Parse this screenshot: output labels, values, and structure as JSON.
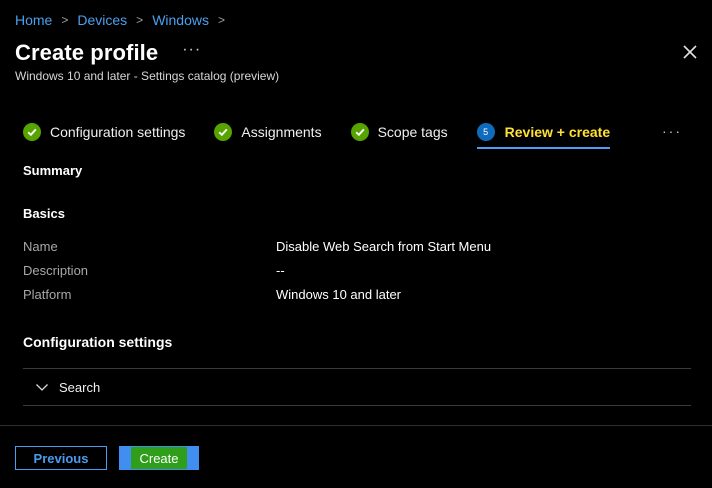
{
  "breadcrumb": {
    "items": [
      "Home",
      "Devices",
      "Windows"
    ]
  },
  "header": {
    "title": "Create profile",
    "subtitle": "Windows 10 and later - Settings catalog (preview)"
  },
  "wizard": {
    "steps": [
      {
        "label": "Configuration settings",
        "state": "complete"
      },
      {
        "label": "Assignments",
        "state": "complete"
      },
      {
        "label": "Scope tags",
        "state": "complete"
      },
      {
        "label": "Review + create",
        "state": "active",
        "number": "5"
      }
    ]
  },
  "summary": {
    "heading": "Summary",
    "basics_heading": "Basics",
    "fields": [
      {
        "label": "Name",
        "value": "Disable Web Search from Start Menu"
      },
      {
        "label": "Description",
        "value": "--"
      },
      {
        "label": "Platform",
        "value": "Windows 10 and later"
      }
    ],
    "config_heading": "Configuration settings",
    "accordion_label": "Search"
  },
  "footer": {
    "previous_label": "Previous",
    "create_label": "Create"
  },
  "colors": {
    "background": "#000000",
    "link": "#4aa0f0",
    "check_green": "#57a300",
    "active_step": "#ffe135"
  },
  "icons": {
    "close": "close-icon",
    "check": "checkmark-icon",
    "chevron": "chevron-down-icon",
    "more": "more-ellipsis-icon"
  }
}
